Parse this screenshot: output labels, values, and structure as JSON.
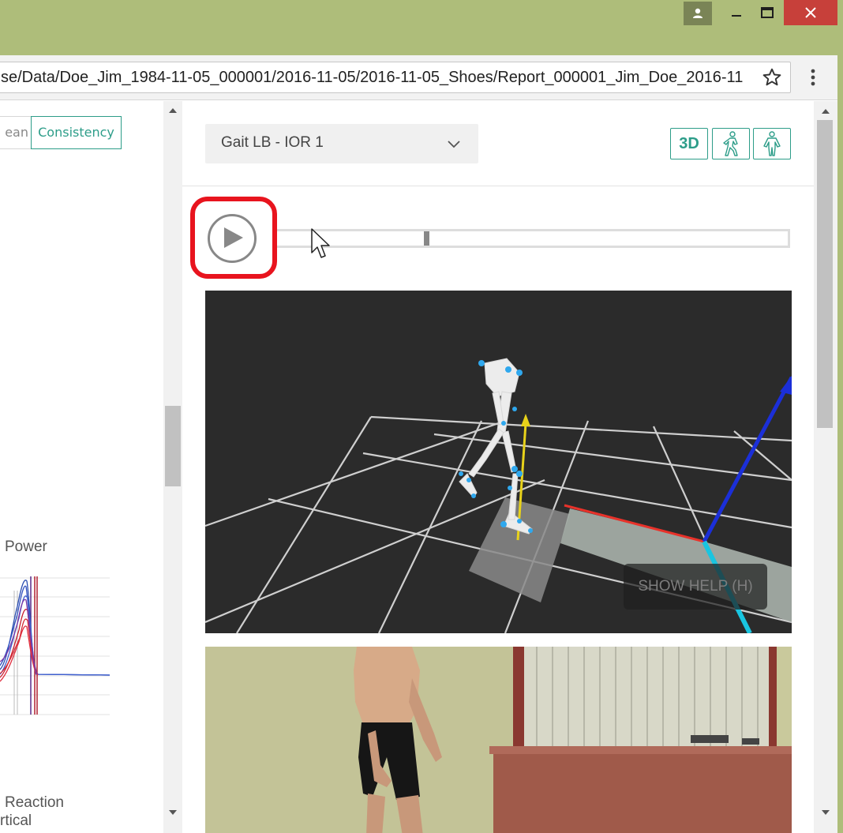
{
  "browser": {
    "url": "se/Data/Doe_Jim_1984-11-05_000001/2016-11-05/2016-11-05_Shoes/Report_000001_Jim_Doe_2016-11"
  },
  "left_panel": {
    "tabs": [
      {
        "label": "ean"
      },
      {
        "label": "Consistency",
        "active": true
      }
    ],
    "labels": {
      "power": "Power",
      "reaction": "Reaction",
      "vertical": "rtical"
    }
  },
  "right_panel": {
    "trial_select": {
      "value": "Gait LB - IOR 1"
    },
    "view_buttons": {
      "three_d": "3D"
    },
    "timeline": {
      "progress": 0.29
    },
    "viewer": {
      "help_label": "SHOW HELP (H)"
    }
  },
  "colors": {
    "accent": "#2d9d89",
    "highlight": "#e8141e",
    "window_frame": "#aebd7a",
    "close_button": "#c7403a"
  }
}
